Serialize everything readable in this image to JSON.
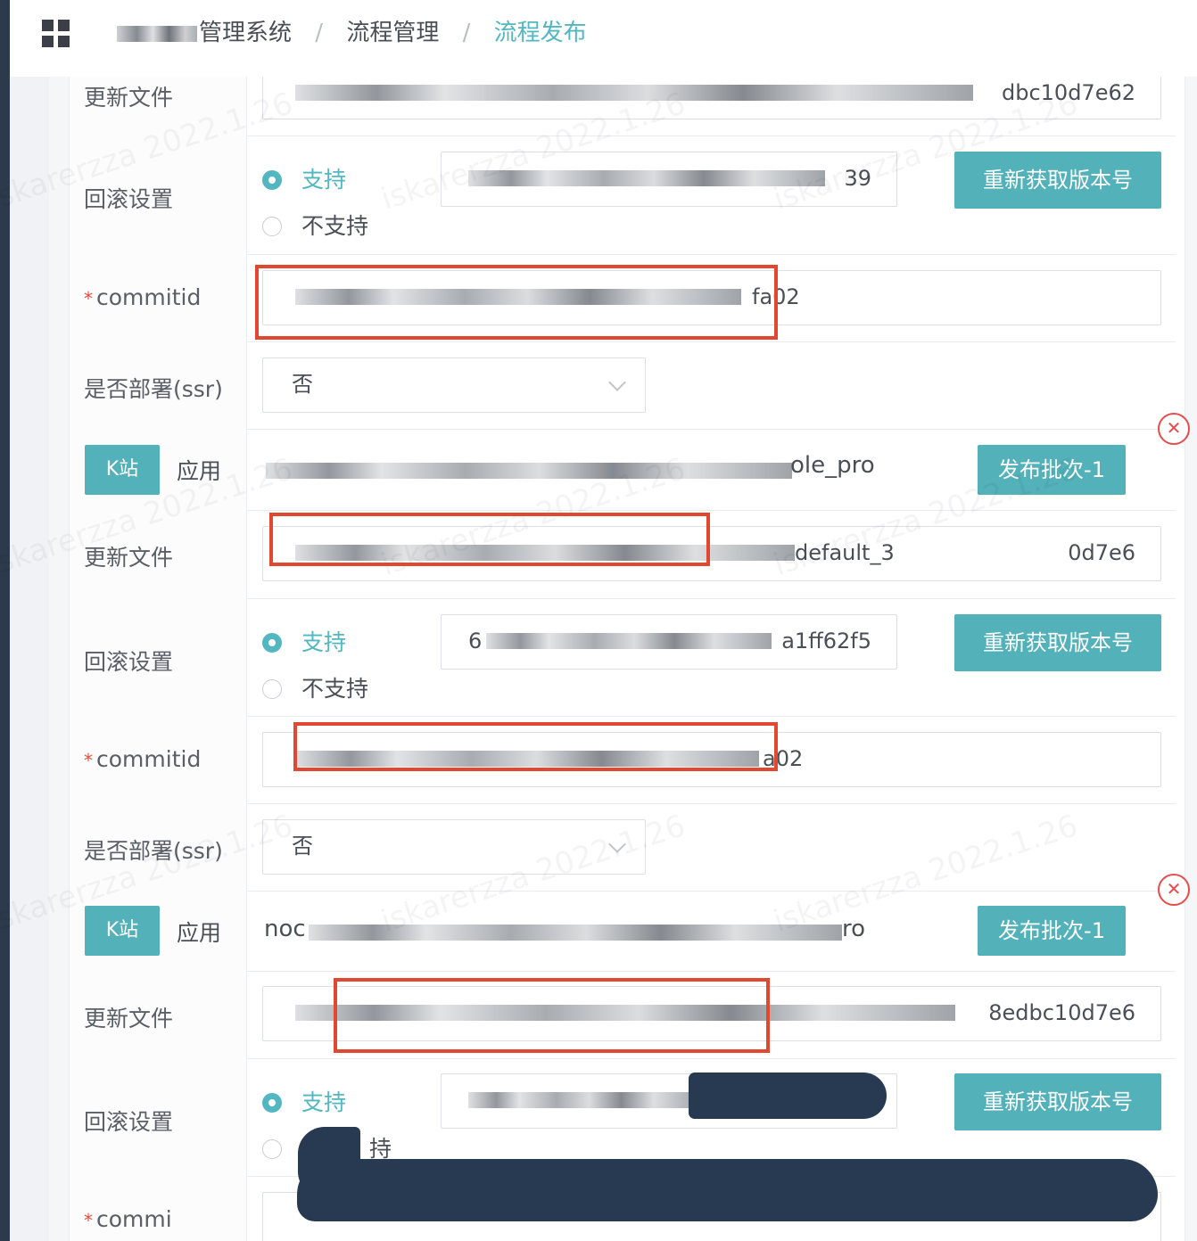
{
  "breadcrumb": {
    "system": "管理系统",
    "module": "流程管理",
    "current": "流程发布",
    "separator": "/"
  },
  "labels": {
    "update_file": "更新文件",
    "rollback": "回滚设置",
    "commitid": "commitid",
    "commitid_required_mark": "*",
    "deploy_ssr": "是否部署(ssr)",
    "app": "应用",
    "commitid_truncated": "commi"
  },
  "radio": {
    "support": "支持",
    "not_support": "不支持",
    "not_support_partial": "持"
  },
  "buttons": {
    "refetch_version": "重新获取版本号",
    "k_station": "K站",
    "batch": "发布批次-1"
  },
  "select": {
    "value": "否"
  },
  "blocks": [
    {
      "update_file_tail": "dbc10d7e62",
      "rollback_version_tail": "39",
      "commit_tail": "fa02"
    },
    {
      "app_tail": "ole_pro",
      "update_file_mid": "default_3",
      "update_file_tail": "0d7e6",
      "rollback_version_head": "6",
      "rollback_version_tail": "a1ff62f5",
      "commit_tail": "a02"
    },
    {
      "app_head": "noc",
      "app_tail": "ro",
      "update_file_tail": "8edbc10d7e6"
    }
  ],
  "colors": {
    "accent": "#52b1b9",
    "highlight_box": "#e2482f",
    "close": "#e74c4c",
    "redaction": "#273a52"
  },
  "icons": {
    "menu": "grid-icon",
    "remove": "close-circle-icon",
    "dropdown": "chevron-down-icon"
  }
}
